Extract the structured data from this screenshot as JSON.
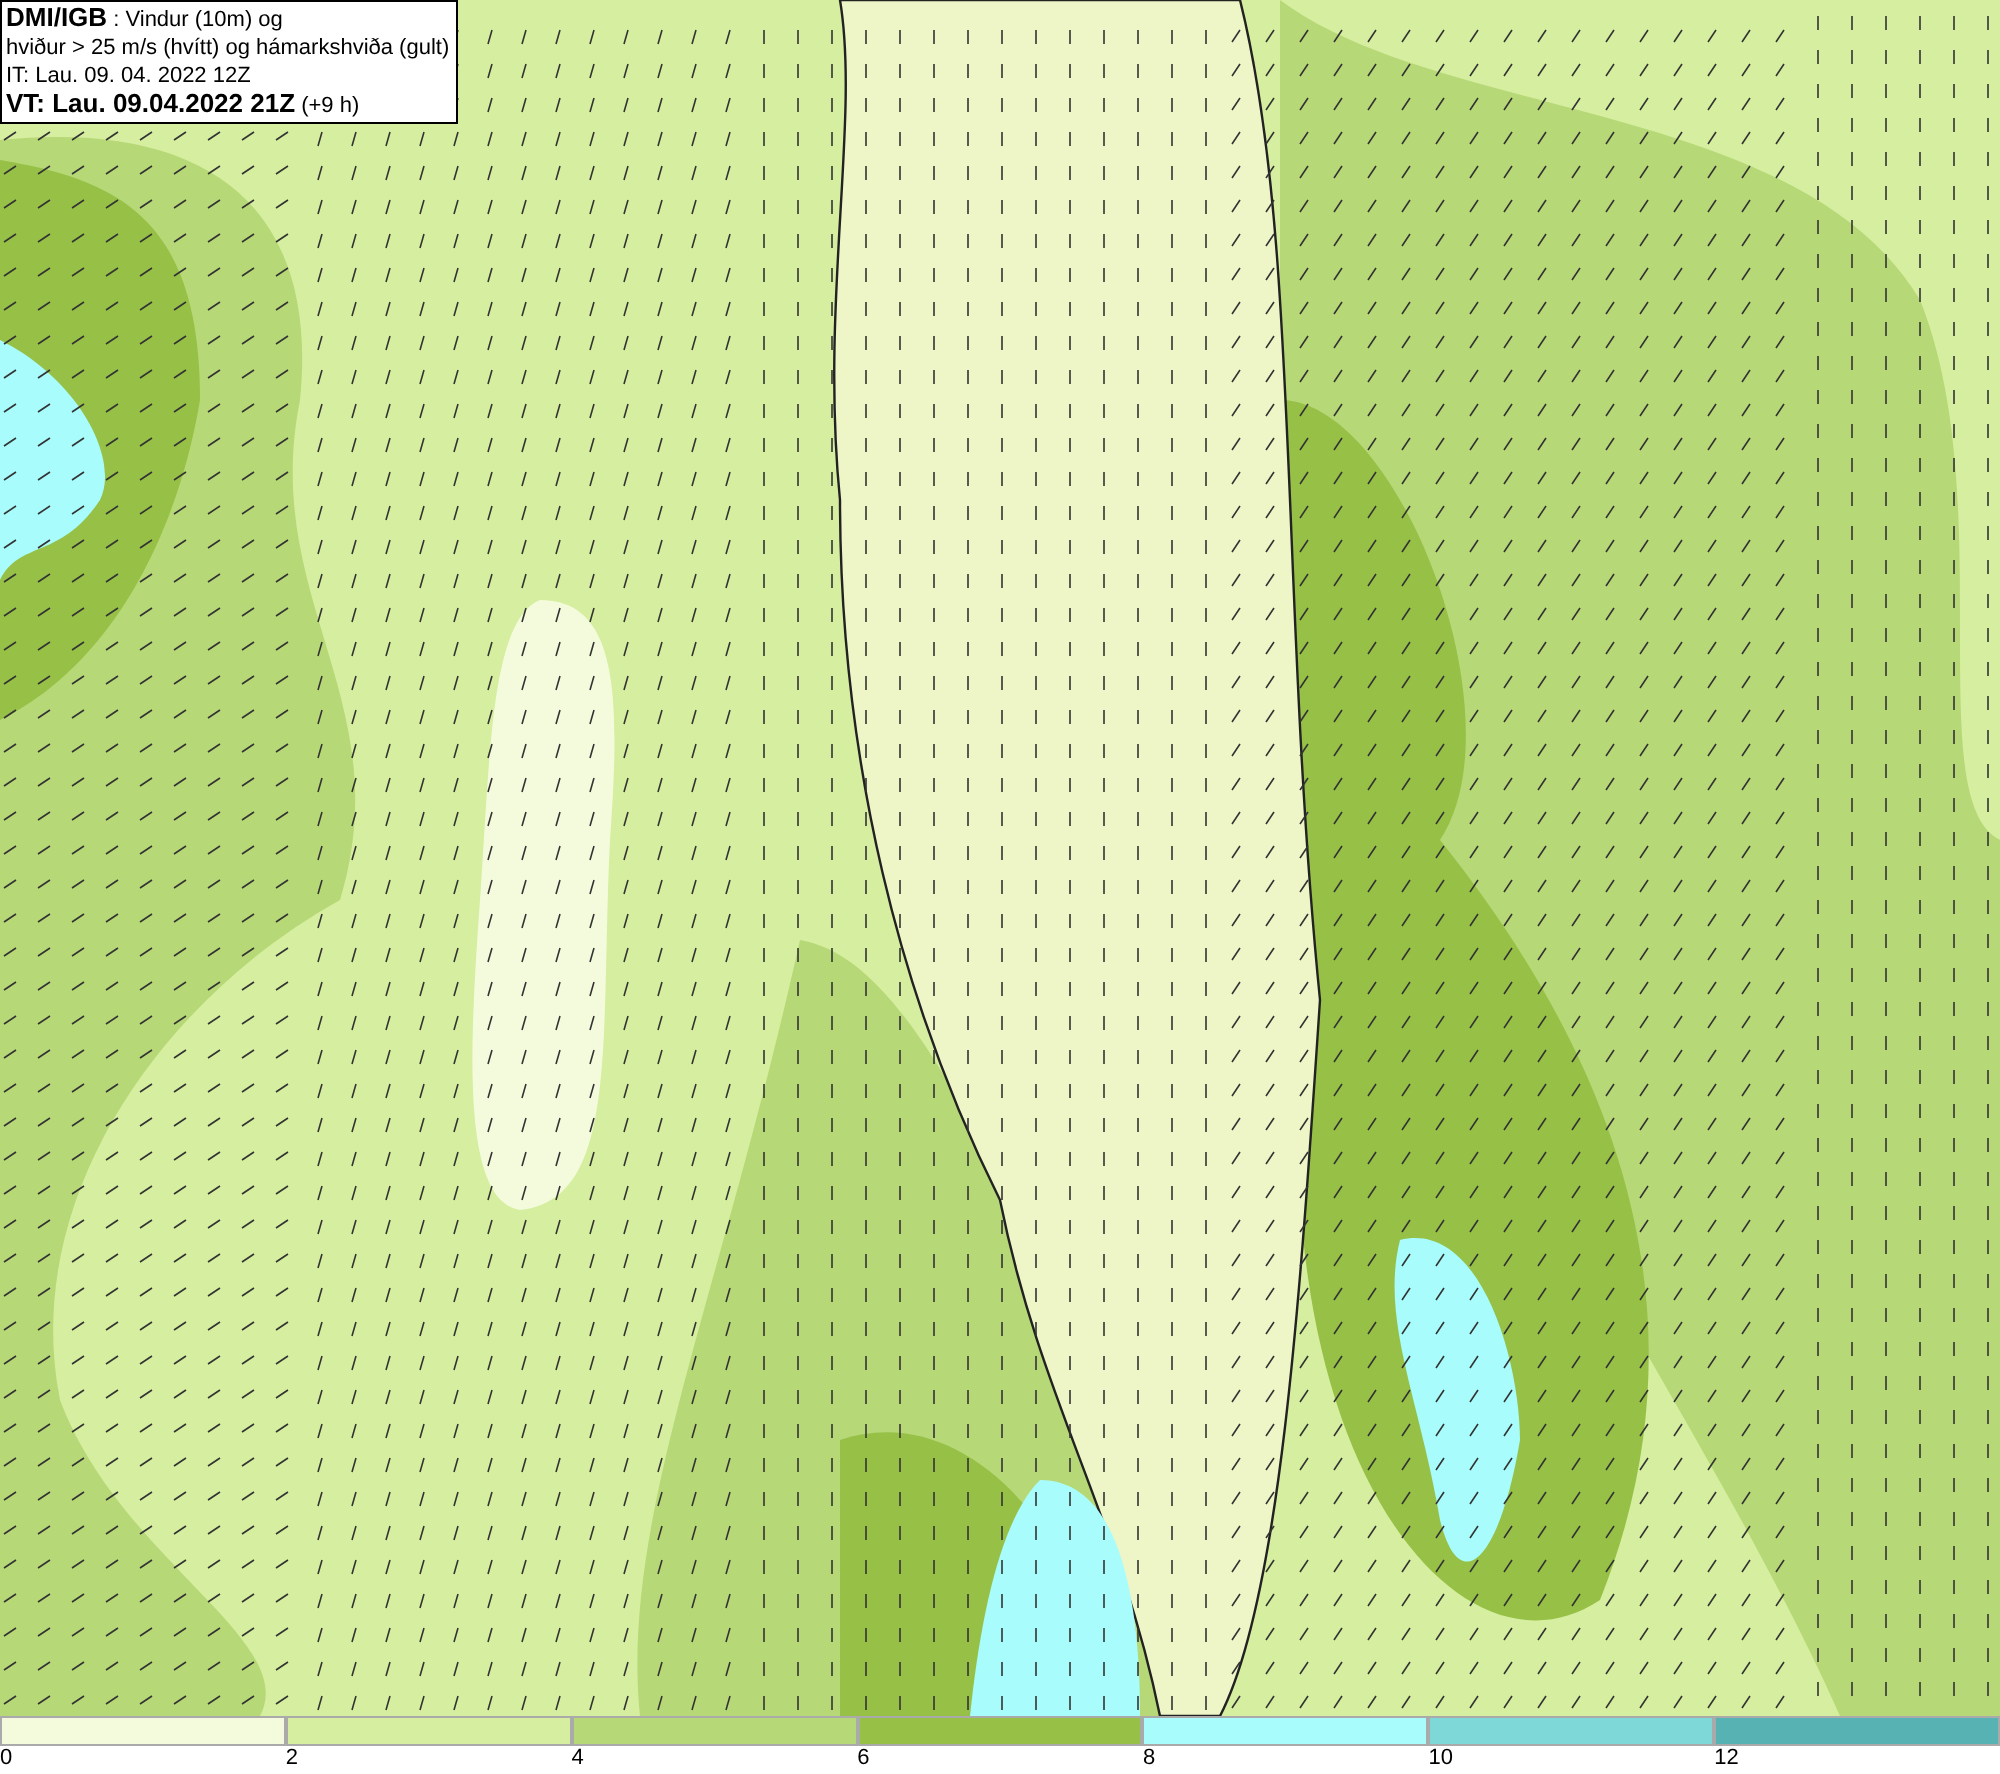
{
  "header": {
    "lines": [
      "**DMI/IGB** : Vindur (10m) og",
      "hviður > 25 m/s (hvítt) og hámarkshviða (gult)",
      "IT: Lau. 09. 04. 2022 12Z",
      "**VT: Lau. 09.04.2022 21Z** (+9 h)"
    ]
  },
  "legend": [
    {
      "label": "0",
      "color": "#f4fbdc"
    },
    {
      "label": "2",
      "color": "#d6ee9f"
    },
    {
      "label": "4",
      "color": "#b6d877"
    },
    {
      "label": "6",
      "color": "#97c047"
    },
    {
      "label": "8",
      "color": "#a8fcfc"
    },
    {
      "label": "10",
      "color": "#7fd8d8"
    },
    {
      "label": "12",
      "color": "#57b3b3"
    }
  ]
}
